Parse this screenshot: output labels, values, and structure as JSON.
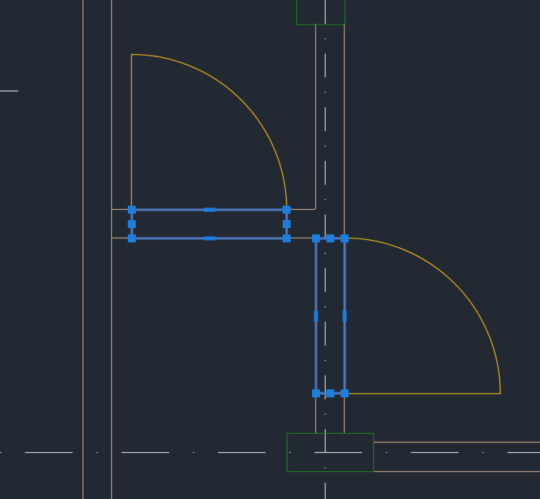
{
  "drawing": {
    "background": "#222933",
    "colors": {
      "wall": "#b9977a",
      "door_swing": "#d8a41a",
      "selection": "#4f77bd",
      "grip": "#1a7fe0",
      "centerline": "#c8ccd2",
      "column_box": "#1f7a1f"
    },
    "objects": [
      {
        "name": "door-horizontal",
        "selected": true
      },
      {
        "name": "door-vertical",
        "selected": true
      }
    ]
  }
}
